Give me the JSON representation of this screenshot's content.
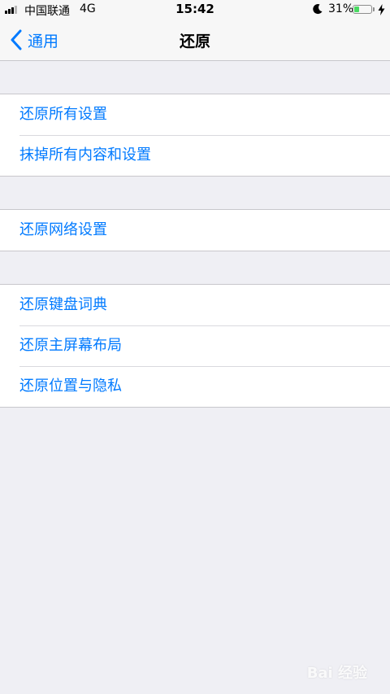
{
  "status_bar": {
    "carrier": "中国联通",
    "network": "4G",
    "time": "15:42",
    "battery_percent_text": "31%",
    "battery_level": 0.31,
    "battery_color": "#4cd964",
    "icons": [
      "signal-icon",
      "moon-icon",
      "battery-icon",
      "charging-icon"
    ]
  },
  "nav": {
    "back_label": "通用",
    "title": "还原",
    "accent_color": "#007aff"
  },
  "groups": [
    {
      "items": [
        {
          "label": "还原所有设置"
        },
        {
          "label": "抹掉所有内容和设置"
        }
      ]
    },
    {
      "items": [
        {
          "label": "还原网络设置"
        }
      ]
    },
    {
      "items": [
        {
          "label": "还原键盘词典"
        },
        {
          "label": "还原主屏幕布局"
        },
        {
          "label": "还原位置与隐私"
        }
      ]
    }
  ],
  "watermark": "Bai 经验"
}
